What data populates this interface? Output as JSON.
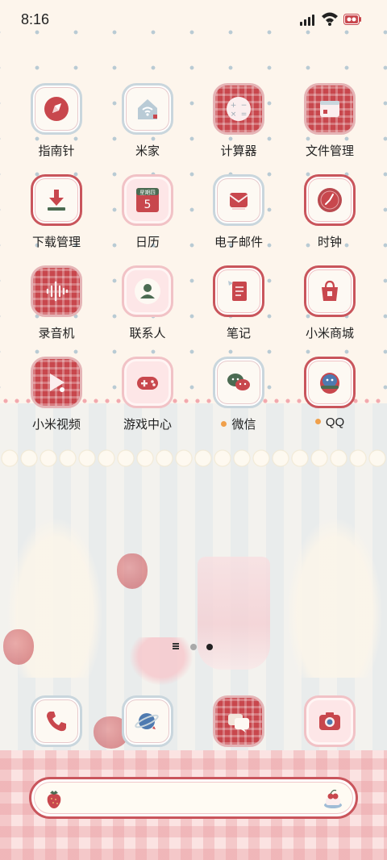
{
  "status_bar": {
    "time": "8:16"
  },
  "apps": [
    {
      "label": "指南针",
      "icon": "compass-icon"
    },
    {
      "label": "米家",
      "icon": "home-wifi-icon"
    },
    {
      "label": "计算器",
      "icon": "calculator-icon"
    },
    {
      "label": "文件管理",
      "icon": "folder-icon"
    },
    {
      "label": "下载管理",
      "icon": "download-icon"
    },
    {
      "label": "日历",
      "icon": "calendar-icon",
      "calendar_weekday": "星期四",
      "calendar_day": "5"
    },
    {
      "label": "电子邮件",
      "icon": "mail-icon"
    },
    {
      "label": "时钟",
      "icon": "clock-icon"
    },
    {
      "label": "录音机",
      "icon": "waveform-icon"
    },
    {
      "label": "联系人",
      "icon": "contact-icon"
    },
    {
      "label": "笔记",
      "icon": "notes-icon"
    },
    {
      "label": "小米商城",
      "icon": "shopping-bag-icon"
    },
    {
      "label": "小米视频",
      "icon": "play-icon"
    },
    {
      "label": "游戏中心",
      "icon": "gamepad-icon"
    },
    {
      "label": "微信",
      "icon": "wechat-icon",
      "new_dot": true
    },
    {
      "label": "QQ",
      "icon": "qq-penguin-icon",
      "new_dot": true
    }
  ],
  "dock": [
    {
      "icon": "phone-icon"
    },
    {
      "icon": "browser-planet-icon"
    },
    {
      "icon": "messages-icon"
    },
    {
      "icon": "camera-icon"
    }
  ],
  "pager": {
    "pages": 2,
    "active": 2
  },
  "search_bar": {
    "left_icon": "strawberry-icon",
    "right_icon": "cherry-cake-icon"
  },
  "colors": {
    "accent_red": "#c8474d",
    "frame_blue": "#c9d6dd",
    "pink": "#fde6e7",
    "dot_orange": "#f0a04b"
  }
}
